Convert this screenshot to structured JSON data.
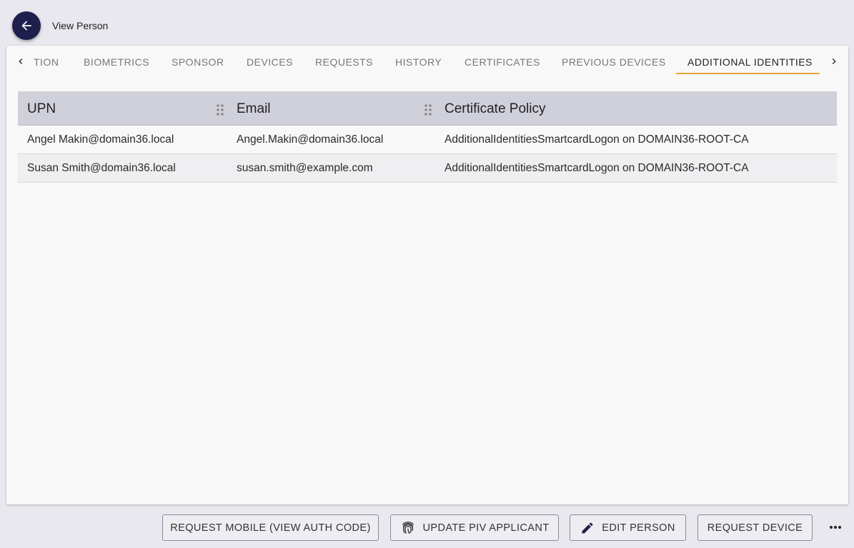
{
  "header": {
    "title": "View Person",
    "back_icon": "arrow-left-icon"
  },
  "tabs": {
    "items": [
      {
        "label": "TION",
        "active": false
      },
      {
        "label": "BIOMETRICS",
        "active": false
      },
      {
        "label": "SPONSOR",
        "active": false
      },
      {
        "label": "DEVICES",
        "active": false
      },
      {
        "label": "REQUESTS",
        "active": false
      },
      {
        "label": "HISTORY",
        "active": false
      },
      {
        "label": "CERTIFICATES",
        "active": false
      },
      {
        "label": "PREVIOUS DEVICES",
        "active": false
      },
      {
        "label": "ADDITIONAL IDENTITIES",
        "active": true
      }
    ],
    "accent_color": "#e8a33d"
  },
  "table": {
    "columns": [
      "UPN",
      "Email",
      "Certificate Policy"
    ],
    "rows": [
      [
        "Angel Makin@domain36.local",
        "Angel.Makin@domain36.local",
        "AdditionalIdentitiesSmartcardLogon on DOMAIN36-ROOT-CA"
      ],
      [
        "Susan Smith@domain36.local",
        "susan.smith@example.com",
        "AdditionalIdentitiesSmartcardLogon on DOMAIN36-ROOT-CA"
      ]
    ]
  },
  "actions": {
    "request_mobile": "REQUEST MOBILE (VIEW AUTH CODE)",
    "update_piv": "UPDATE PIV APPLICANT",
    "edit_person": "EDIT PERSON",
    "request_device": "REQUEST DEVICE",
    "more_icon": "more-horizontal-icon"
  },
  "colors": {
    "back_button": "#1f1f4d",
    "header_bg": "#d0d0da"
  }
}
